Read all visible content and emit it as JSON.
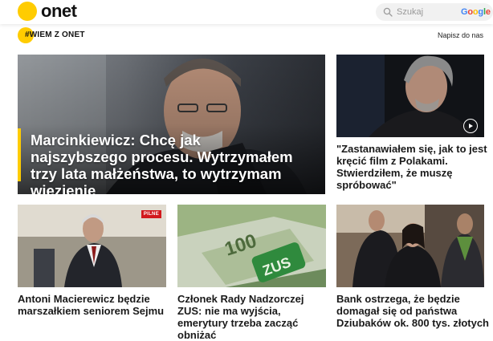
{
  "header": {
    "logo_text": "onet",
    "search_placeholder": "Szukaj",
    "search_engine": "Google",
    "accent_color": "#ffcc00"
  },
  "subheader": {
    "tag": "#WIEM Z ONET",
    "write_link": "Napisz do nas"
  },
  "articles": {
    "hero": {
      "title": "Marcinkiewicz: Chcę jak najszybszego procesu. Wytrzymałem trzy lata małżeństwa, to wytrzymam więzienie"
    },
    "right_top": {
      "title": "\"Zastanawiałem się, jak to jest kręcić film z Polakami. Stwierdziłem, że muszę spróbować\"",
      "media": "play-icon"
    },
    "row2_a": {
      "title": "Antoni Macierewicz będzie marszałkiem seniorem Sejmu",
      "badge": "PILNE",
      "badge_color": "#d2191d"
    },
    "row2_b": {
      "title": "Członek Rady Nadzorczej ZUS: nie ma wyjścia, emerytury trzeba zacząć obniżać",
      "banknote": "100",
      "stamp": "ZUS"
    },
    "row2_c": {
      "title": "Bank ostrzega, że będzie domagał się od państwa Dziubaków ok. 800 tys. złotych"
    }
  }
}
